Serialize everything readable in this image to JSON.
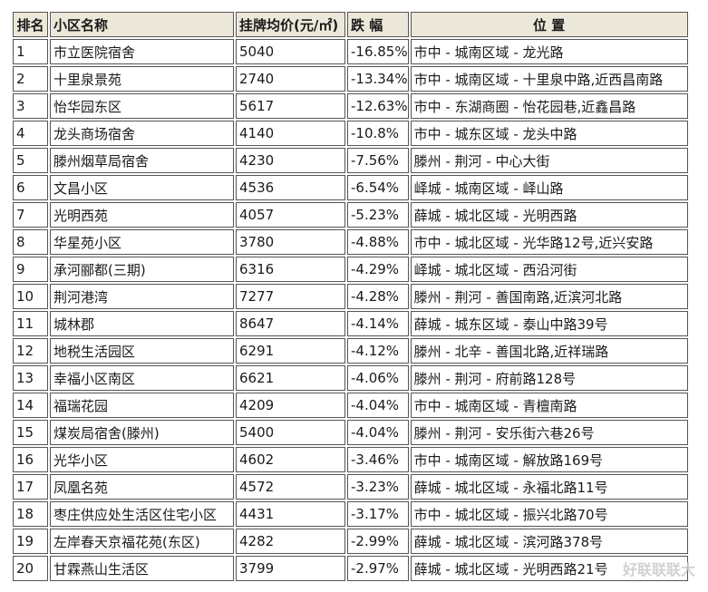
{
  "table": {
    "headers": [
      "排名",
      "小区名称",
      "挂牌均价(元/㎡)",
      "跌 幅",
      "位 置"
    ],
    "rows": [
      [
        "1",
        "市立医院宿舍",
        "5040",
        "-16.85%",
        "市中 - 城南区域 - 龙光路"
      ],
      [
        "2",
        "十里泉景苑",
        "2740",
        "-13.34%",
        "市中 - 城南区域 - 十里泉中路,近西昌南路"
      ],
      [
        "3",
        "怡华园东区",
        "5617",
        "-12.63%",
        "市中 - 东湖商圈 - 怡花园巷,近鑫昌路"
      ],
      [
        "4",
        "龙头商场宿舍",
        "4140",
        "-10.8%",
        "市中 - 城东区域 - 龙头中路"
      ],
      [
        "5",
        "滕州烟草局宿舍",
        "4230",
        "-7.56%",
        "滕州 - 荆河 - 中心大街"
      ],
      [
        "6",
        "文昌小区",
        "4536",
        "-6.54%",
        "峄城 - 城南区域 - 峄山路"
      ],
      [
        "7",
        "光明西苑",
        "4057",
        "-5.23%",
        "薛城 - 城北区域 - 光明西路"
      ],
      [
        "8",
        "华星苑小区",
        "3780",
        "-4.88%",
        "市中 - 城北区域 - 光华路12号,近兴安路"
      ],
      [
        "9",
        "承河郦都(三期)",
        "6316",
        "-4.29%",
        "峄城 - 城北区域 - 西沿河街"
      ],
      [
        "10",
        "荆河港湾",
        "7277",
        "-4.28%",
        "滕州 - 荆河 - 善国南路,近滨河北路"
      ],
      [
        "11",
        "城林郡",
        "8647",
        "-4.14%",
        "薛城 - 城东区域 - 泰山中路39号"
      ],
      [
        "12",
        "地税生活园区",
        "6291",
        "-4.12%",
        "滕州 - 北辛 - 善国北路,近祥瑞路"
      ],
      [
        "13",
        "幸福小区南区",
        "6621",
        "-4.06%",
        "滕州 - 荆河 - 府前路128号"
      ],
      [
        "14",
        "福瑞花园",
        "4209",
        "-4.04%",
        "市中 - 城南区域 - 青檀南路"
      ],
      [
        "15",
        "煤炭局宿舍(滕州)",
        "5400",
        "-4.04%",
        "滕州 - 荆河 - 安乐街六巷26号"
      ],
      [
        "16",
        "光华小区",
        "4602",
        "-3.46%",
        "市中 - 城南区域 - 解放路169号"
      ],
      [
        "17",
        "凤凰名苑",
        "4572",
        "-3.23%",
        "薛城 - 城北区域 - 永福北路11号"
      ],
      [
        "18",
        "枣庄供应处生活区住宅小区",
        "4431",
        "-3.17%",
        "市中 - 城北区域 - 振兴北路70号"
      ],
      [
        "19",
        "左岸春天京福花苑(东区)",
        "4282",
        "-2.99%",
        "薛城 - 城北区域 - 滨河路378号"
      ],
      [
        "20",
        "甘霖燕山生活区",
        "3799",
        "-2.97%",
        "薛城 - 城北区域 - 光明西路21号"
      ]
    ]
  },
  "watermark": "好联联联大",
  "colors": {
    "header_bg": "#ece8d9",
    "change_text": "#2e7d32",
    "border": "#555555"
  }
}
